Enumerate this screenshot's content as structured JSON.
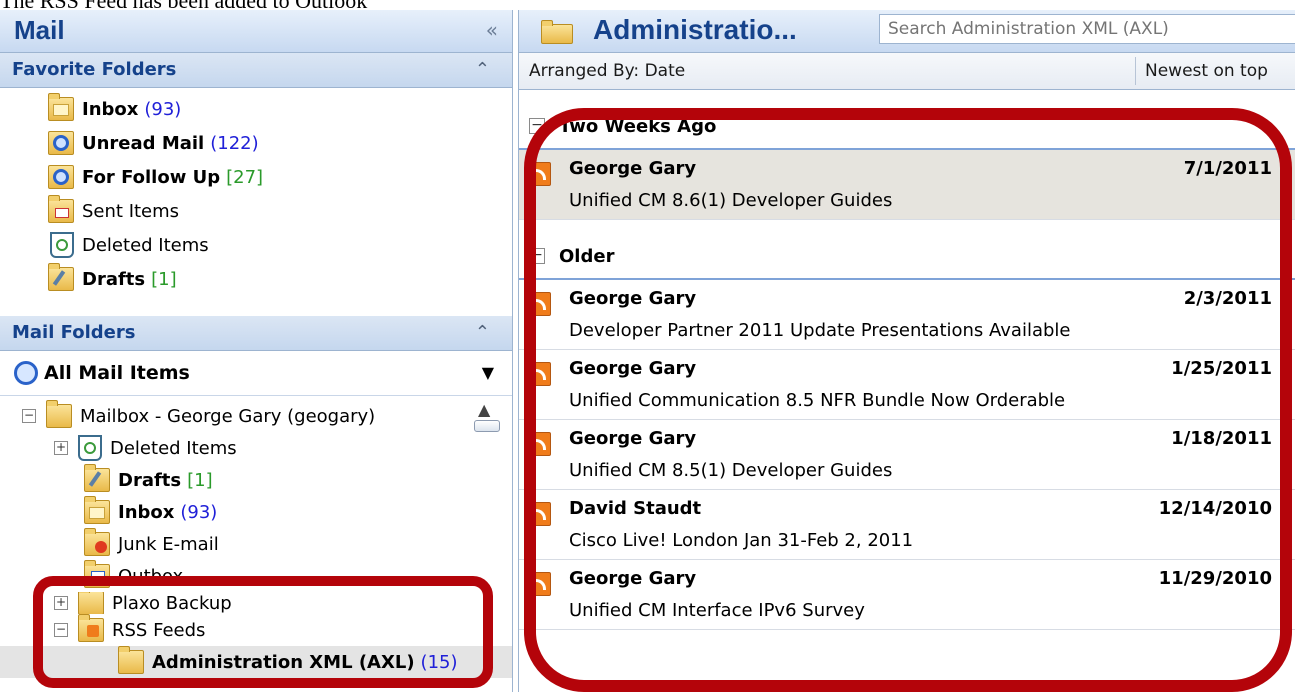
{
  "caption": "The RSS Feed has been added to Outlook",
  "nav": {
    "title": "Mail",
    "collapse_glyph": "«",
    "favorite_folders": {
      "title": "Favorite Folders",
      "items": [
        {
          "label": "Inbox",
          "count": "(93)",
          "count_color": "blue",
          "bold": true,
          "icon": "inbox-folder-icon"
        },
        {
          "label": "Unread Mail",
          "count": "(122)",
          "count_color": "blue",
          "bold": true,
          "icon": "search-folder-icon"
        },
        {
          "label": "For Follow Up",
          "count": "[27]",
          "count_color": "green",
          "bold": true,
          "icon": "search-folder-icon"
        },
        {
          "label": "Sent Items",
          "count": "",
          "bold": false,
          "icon": "sent-items-icon"
        },
        {
          "label": "Deleted Items",
          "count": "",
          "bold": false,
          "icon": "deleted-items-icon"
        },
        {
          "label": "Drafts",
          "count": "[1]",
          "count_color": "green",
          "bold": true,
          "icon": "drafts-icon"
        }
      ]
    },
    "mail_folders": {
      "title": "Mail Folders",
      "view_selector": "All Mail Items",
      "tree": [
        {
          "label": "Mailbox - George Gary (geogary)",
          "expander": "−"
        },
        {
          "label": "Deleted Items",
          "expander": "+"
        },
        {
          "label": "Drafts",
          "count": "[1]"
        },
        {
          "label": "Inbox",
          "count": "(93)"
        },
        {
          "label": "Junk E-mail"
        },
        {
          "label": "Outbox"
        },
        {
          "label": "Plaxo Backup",
          "expander": "+"
        },
        {
          "label": "RSS Feeds",
          "expander": "−"
        },
        {
          "label": "Administration XML (AXL)",
          "count": "(15)"
        }
      ]
    }
  },
  "list": {
    "title": "Administratio...",
    "search_placeholder": "Search Administration XML (AXL)",
    "arranged_by": "Arranged By: Date",
    "sort_label": "Newest on top",
    "groups": [
      {
        "title": "Two Weeks Ago",
        "expander": "−",
        "messages": [
          {
            "sender": "George Gary",
            "date": "7/1/2011",
            "subject": "Unified CM 8.6(1) Developer Guides",
            "selected": true
          }
        ]
      },
      {
        "title": "Older",
        "expander": "−",
        "messages": [
          {
            "sender": "George Gary",
            "date": "2/3/2011",
            "subject": "Developer Partner 2011 Update Presentations Available"
          },
          {
            "sender": "George Gary",
            "date": "1/25/2011",
            "subject": "Unified Communication 8.5 NFR Bundle Now Orderable"
          },
          {
            "sender": "George Gary",
            "date": "1/18/2011",
            "subject": "Unified CM 8.5(1) Developer Guides"
          },
          {
            "sender": "David Staudt",
            "date": "12/14/2010",
            "subject": "Cisco Live! London Jan 31-Feb 2, 2011"
          },
          {
            "sender": "George Gary",
            "date": "11/29/2010",
            "subject": "Unified CM Interface IPv6 Survey"
          }
        ]
      }
    ]
  },
  "colors": {
    "highlight": "#b4040a",
    "header_text": "#15428b",
    "count_blue": "#2020d8",
    "count_green": "#2a9a2a"
  }
}
